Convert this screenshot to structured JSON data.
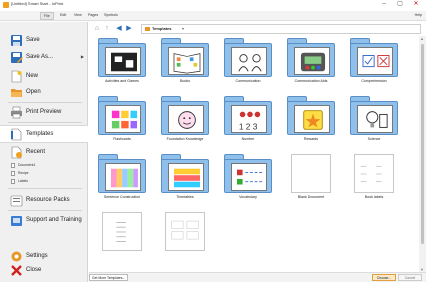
{
  "window": {
    "title": "[Untitled] Smart Start - InPrint",
    "controls": [
      "–",
      "▢",
      "✕"
    ]
  },
  "menubar": {
    "tabs": [
      "File",
      "Edit",
      "View",
      "Pages",
      "Symbols"
    ],
    "active": "File",
    "help": "Help"
  },
  "sidebar": {
    "save": "Save",
    "save_as": "Save As...",
    "new": "New",
    "open": "Open",
    "print_preview": "Print Preview",
    "templates": "Templates",
    "recent": "Recent",
    "recent_files": [
      "Document1",
      "Recipe",
      "Labels"
    ],
    "resource_packs": "Resource Packs",
    "support": "Support and Training",
    "settings": "Settings",
    "close": "Close",
    "accent": "#e8962a"
  },
  "navigation": {
    "breadcrumb": "Templates",
    "icons": [
      "home-icon",
      "up-icon",
      "back-icon",
      "forward-icon"
    ]
  },
  "templates": [
    {
      "label": "Activities and Games",
      "kind": "folder",
      "icon": "puzzle"
    },
    {
      "label": "Books",
      "kind": "folder",
      "icon": "book"
    },
    {
      "label": "Communication",
      "kind": "folder",
      "icon": "talking"
    },
    {
      "label": "Communication Aids",
      "kind": "folder",
      "icon": "device"
    },
    {
      "label": "Comprehension",
      "kind": "folder",
      "icon": "checkbox"
    },
    {
      "label": "Flashcards",
      "kind": "folder",
      "icon": "flashcards"
    },
    {
      "label": "Foundation Knowledge",
      "kind": "folder",
      "icon": "face"
    },
    {
      "label": "Number",
      "kind": "folder",
      "icon": "counting"
    },
    {
      "label": "Rewards",
      "kind": "folder",
      "icon": "star"
    },
    {
      "label": "Science",
      "kind": "folder",
      "icon": "lightbulb"
    },
    {
      "label": "Sentence Construction",
      "kind": "folder",
      "icon": "grid-colors"
    },
    {
      "label": "Timetables",
      "kind": "folder",
      "icon": "timetable"
    },
    {
      "label": "Vocabulary",
      "kind": "folder",
      "icon": "vocab"
    },
    {
      "label": "Blank Document",
      "kind": "document",
      "icon": "blank"
    },
    {
      "label": "Book labels",
      "kind": "document",
      "icon": "labels"
    },
    {
      "label": "",
      "kind": "document",
      "icon": "list"
    },
    {
      "label": "",
      "kind": "document",
      "icon": "grid"
    }
  ],
  "footer": {
    "get_more": "Get More Templates...",
    "open": "Choose...",
    "cancel": "Cancel"
  },
  "colors": {
    "folder": "#8fc0ec",
    "folder_border": "#5a8fc6"
  }
}
